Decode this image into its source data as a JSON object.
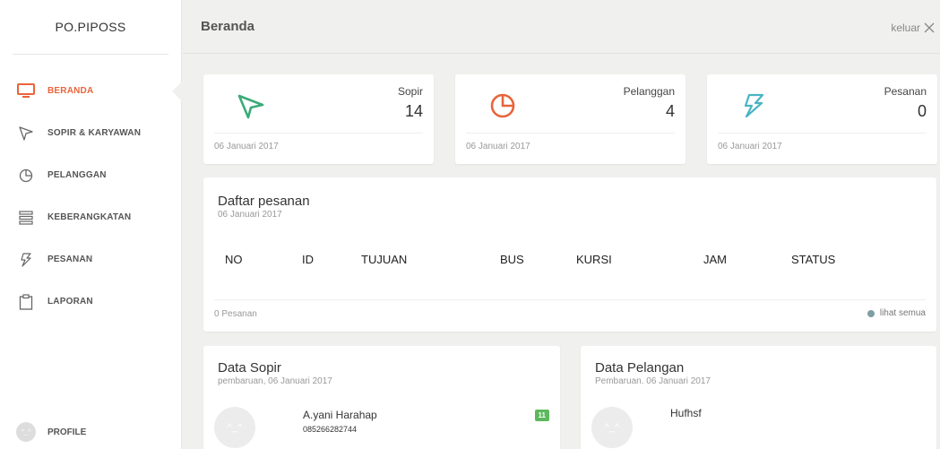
{
  "sidebar": {
    "brand": "PO.PIPOSS",
    "items": [
      {
        "label": "BERANDA",
        "icon": "monitor-icon"
      },
      {
        "label": "SOPIR & KARYAWAN",
        "icon": "send-icon"
      },
      {
        "label": "PELANGGAN",
        "icon": "pie-chart-icon"
      },
      {
        "label": "KEBERANGKATAN",
        "icon": "list-icon"
      },
      {
        "label": "PESANAN",
        "icon": "lightning-icon"
      },
      {
        "label": "LAPORAN",
        "icon": "clipboard-icon"
      }
    ],
    "profile_label": "PROFILE",
    "avatar_face": "^_^"
  },
  "header": {
    "title": "Beranda",
    "logout_label": "keluar"
  },
  "stats": [
    {
      "label": "Sopir",
      "value": "14",
      "date": "06 Januari 2017",
      "icon": "send-icon",
      "color": "#3bab77"
    },
    {
      "label": "Pelanggan",
      "value": "4",
      "date": "06 Januari 2017",
      "icon": "pie-chart-icon",
      "color": "#e8643c"
    },
    {
      "label": "Pesanan",
      "value": "0",
      "date": "06 Januari 2017",
      "icon": "lightning-icon",
      "color": "#4ab4c4"
    }
  ],
  "orders": {
    "title": "Daftar pesanan",
    "subtitle": "06 Januari 2017",
    "columns": [
      "NO",
      "ID",
      "TUJUAN",
      "BUS",
      "KURSI",
      "JAM",
      "STATUS"
    ],
    "count_text": "0 Pesanan",
    "see_all": "lihat semua"
  },
  "drivers": {
    "title": "Data Sopir",
    "subtitle": "pembaruan, 06 Januari 2017",
    "first": {
      "name": "A.yani Harahap",
      "phone": "085266282744",
      "badge": "11",
      "face": "^_^"
    }
  },
  "customers": {
    "title": "Data Pelangan",
    "subtitle": "Pembaruan. 06 Januari 2017",
    "first": {
      "name": "Hufhsf",
      "face": "^_^"
    }
  },
  "colors": {
    "accent": "#e8643c",
    "sidebar_bg": "#ffffff",
    "page_bg": "#f0f0ee",
    "badge": "#5cb85c"
  }
}
